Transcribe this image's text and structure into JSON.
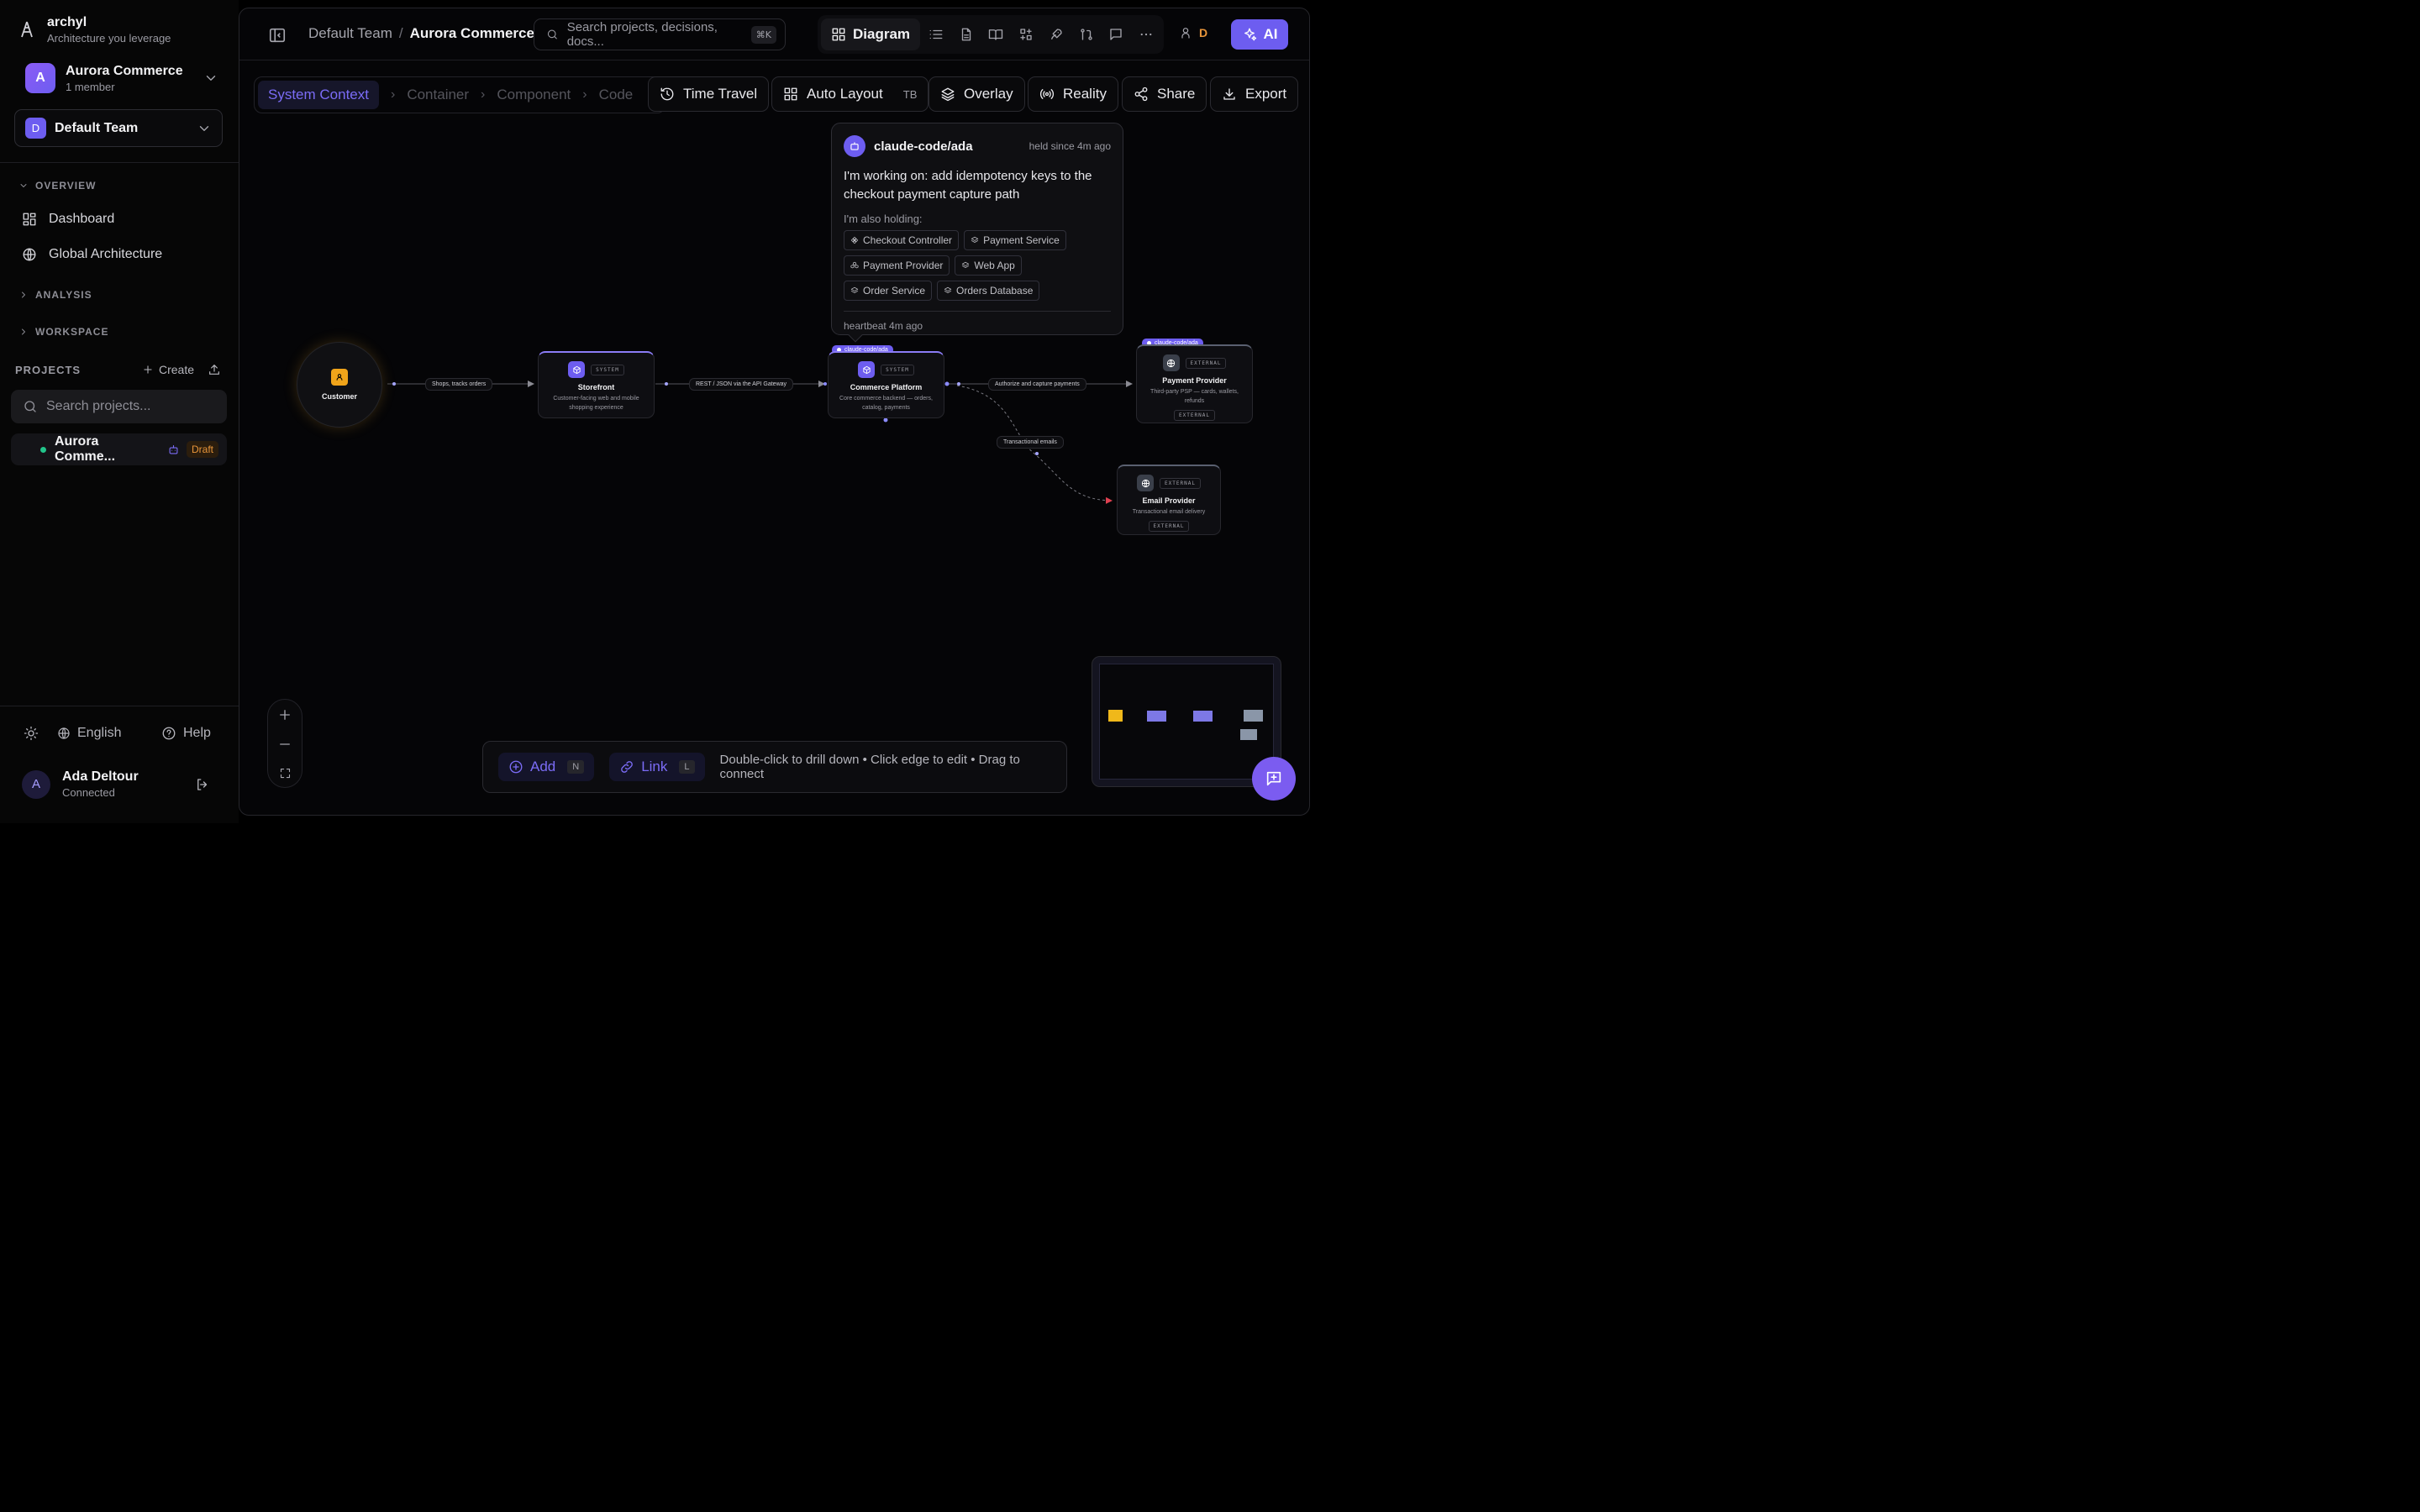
{
  "brand": {
    "name": "archyl",
    "tagline": "Architecture you leverage"
  },
  "project_switcher": {
    "initial": "A",
    "name": "Aurora Commerce",
    "members": "1 member"
  },
  "team_select": {
    "initial": "D",
    "name": "Default Team"
  },
  "sidebar": {
    "overview_label": "OVERVIEW",
    "items": [
      {
        "label": "Dashboard"
      },
      {
        "label": "Global Architecture"
      }
    ],
    "analysis_label": "ANALYSIS",
    "workspace_label": "WORKSPACE",
    "projects_label": "PROJECTS",
    "create_label": "Create",
    "search_placeholder": "Search projects...",
    "project_item": {
      "name": "Aurora Comme...",
      "badge": "Draft"
    },
    "language": "English",
    "help": "Help",
    "user": {
      "initial": "A",
      "name": "Ada Deltour",
      "status": "Connected"
    }
  },
  "topbar": {
    "breadcrumb": {
      "team": "Default Team",
      "separator": "/",
      "project": "Aurora Commerce"
    },
    "search_placeholder": "Search projects, decisions, docs...",
    "search_shortcut": "⌘K",
    "view_active": "Diagram",
    "presence_initial": "D",
    "ai_label": "AI"
  },
  "levels": [
    "System Context",
    "Container",
    "Component",
    "Code"
  ],
  "toolbar": {
    "time_travel": "Time Travel",
    "auto_layout": "Auto Layout",
    "auto_layout_dir": "TB",
    "overlay": "Overlay",
    "reality": "Reality",
    "share": "Share",
    "export": "Export"
  },
  "popover": {
    "agent": "claude-code/ada",
    "since": "held since 4m ago",
    "message": "I'm working on: add idempotency keys to the checkout payment capture path",
    "holding_label": "I'm also holding:",
    "chips": [
      "Checkout Controller",
      "Payment Service",
      "Payment Provider",
      "Web App",
      "Order Service",
      "Orders Database"
    ],
    "heartbeat": "heartbeat 4m ago"
  },
  "diagram": {
    "customer": {
      "label": "Customer"
    },
    "storefront": {
      "tag": "SYSTEM",
      "title": "Storefront",
      "desc": "Customer-facing web and mobile shopping experience"
    },
    "platform": {
      "lock": "claude-code/ada",
      "tag": "SYSTEM",
      "title": "Commerce Platform",
      "desc": "Core commerce backend — orders, catalog, payments"
    },
    "payment": {
      "lock": "claude-code/ada",
      "tag": "EXTERNAL",
      "title": "Payment Provider",
      "desc": "Third-party PSP — cards, wallets, refunds",
      "footer_tag": "EXTERNAL"
    },
    "email": {
      "tag": "EXTERNAL",
      "title": "Email Provider",
      "desc": "Transactional email delivery",
      "footer_tag": "EXTERNAL"
    },
    "edges": {
      "shops": "Shops, tracks orders",
      "rest": "REST / JSON via the API Gateway",
      "authorize": "Authorize and capture payments",
      "emails": "Transactional emails"
    },
    "colors": {
      "system": "#6d5df0",
      "external": "#3a3f4a",
      "person": "#f0a41a",
      "edge_warning": "#e04050"
    }
  },
  "bottom": {
    "add": "Add",
    "add_key": "N",
    "link": "Link",
    "link_key": "L",
    "hint": "Double-click to drill down • Click edge to edit • Drag to connect"
  }
}
